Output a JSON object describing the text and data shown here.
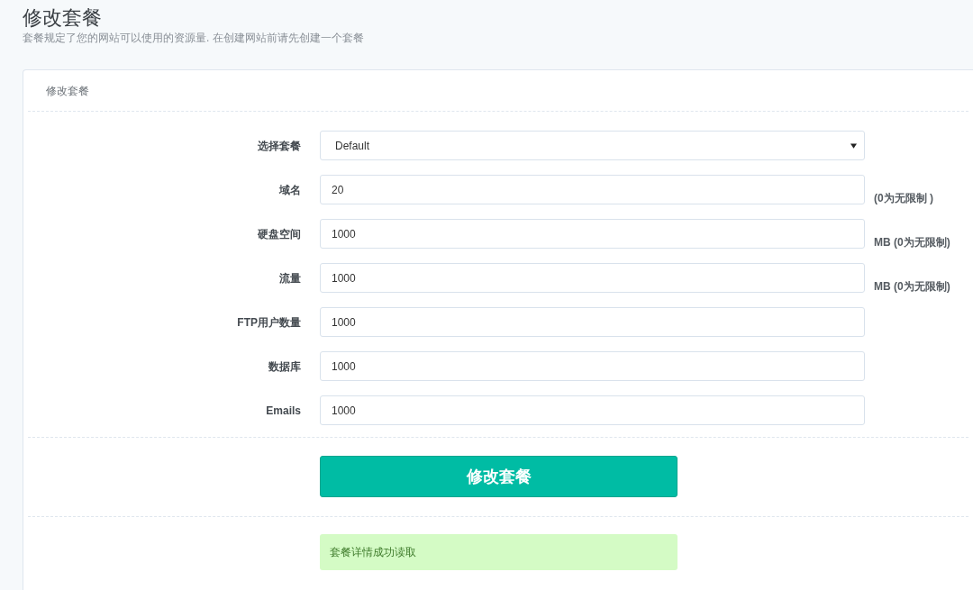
{
  "page": {
    "title": "修改套餐",
    "subtitle": "套餐规定了您的网站可以使用的资源量. 在创建网站前请先创建一个套餐"
  },
  "card": {
    "title": "修改套餐"
  },
  "fields": [
    {
      "kind": "select",
      "label": "选择套餐",
      "value": "Default"
    },
    {
      "kind": "input",
      "label": "域名",
      "value": "20",
      "hint": "(0为无限制 )"
    },
    {
      "kind": "input",
      "label": "硬盘空间",
      "value": "1000",
      "hint": "MB (0为无限制)"
    },
    {
      "kind": "input",
      "label": "流量",
      "value": "1000",
      "hint": "MB (0为无限制)"
    },
    {
      "kind": "input",
      "label": "FTP用户数量",
      "value": "1000"
    },
    {
      "kind": "input",
      "label": "数据库",
      "value": "1000"
    },
    {
      "kind": "input",
      "label": "Emails",
      "value": "1000"
    }
  ],
  "submit": {
    "label": "修改套餐"
  },
  "alert": {
    "text": "套餐详情成功读取"
  }
}
